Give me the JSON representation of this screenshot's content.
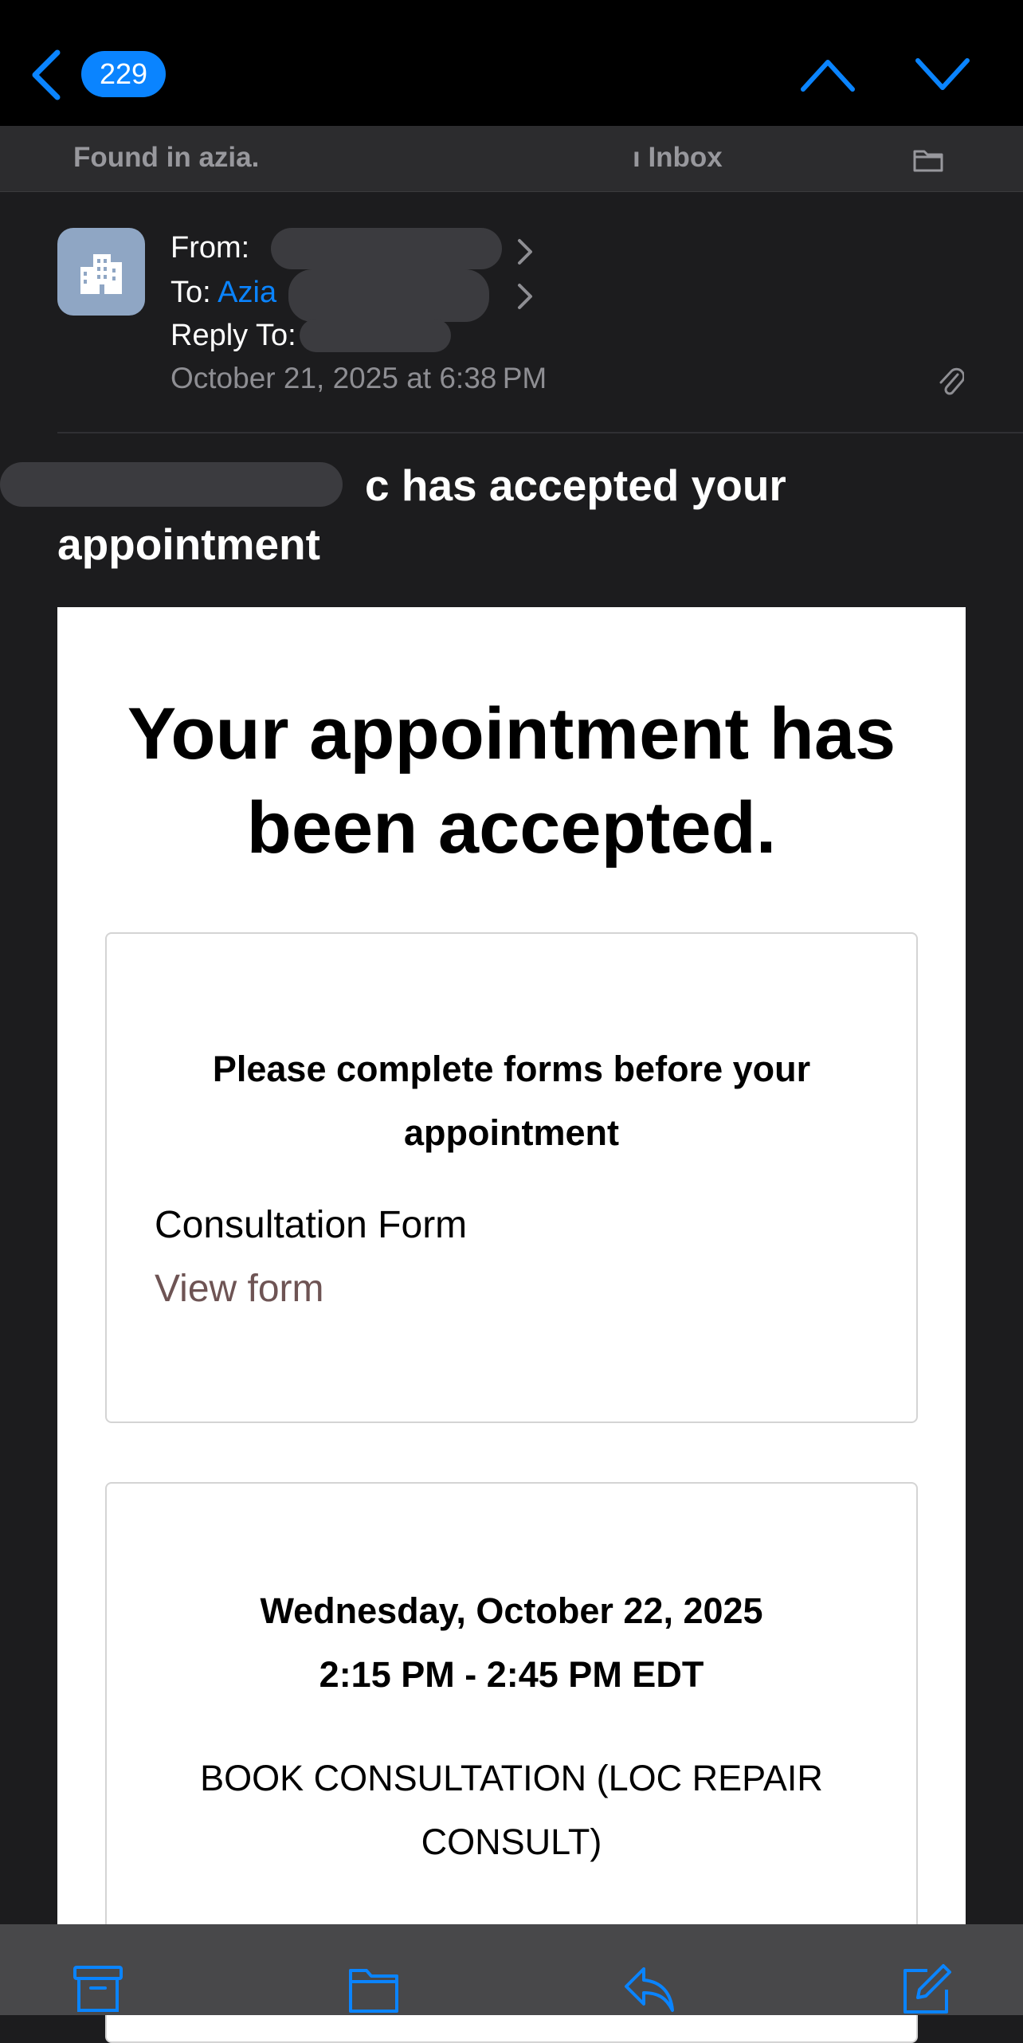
{
  "colors": {
    "accent": "#0a84ff",
    "link": "#6e5454",
    "background": "#1c1c1e"
  },
  "topbar": {
    "unread_count": "229",
    "icons": [
      "back-chevron-icon",
      "chevron-up-icon",
      "chevron-down-icon"
    ]
  },
  "found_bar": {
    "found_text": "Found in azia.",
    "mailbox_text": "ı Inbox",
    "icon": "folder-icon"
  },
  "header": {
    "avatar_icon": "building-icon",
    "from_label": "From:",
    "from_value": "",
    "to_label": "To:",
    "to_value": "Azia",
    "reply_to_label": "Reply To:",
    "date": "October 21, 2025 at 6:38 PM",
    "attachment_icon": "paperclip-icon"
  },
  "subject": {
    "text": "c has accepted your appointment"
  },
  "card": {
    "title": "Your appointment has been accepted.",
    "forms_box": {
      "heading": "Please complete forms before your appointment",
      "form_name": "Consultation Form",
      "view_link": "View form"
    },
    "appointment_box": {
      "date_line": "Wednesday, October 22, 2025",
      "time_line": "2:15 PM - 2:45 PM EDT",
      "service": "BOOK CONSULTATION (LOC REPAIR CONSULT)"
    }
  },
  "toolbar": {
    "icons": [
      "archive-icon",
      "folder-icon",
      "reply-icon",
      "compose-icon"
    ]
  }
}
